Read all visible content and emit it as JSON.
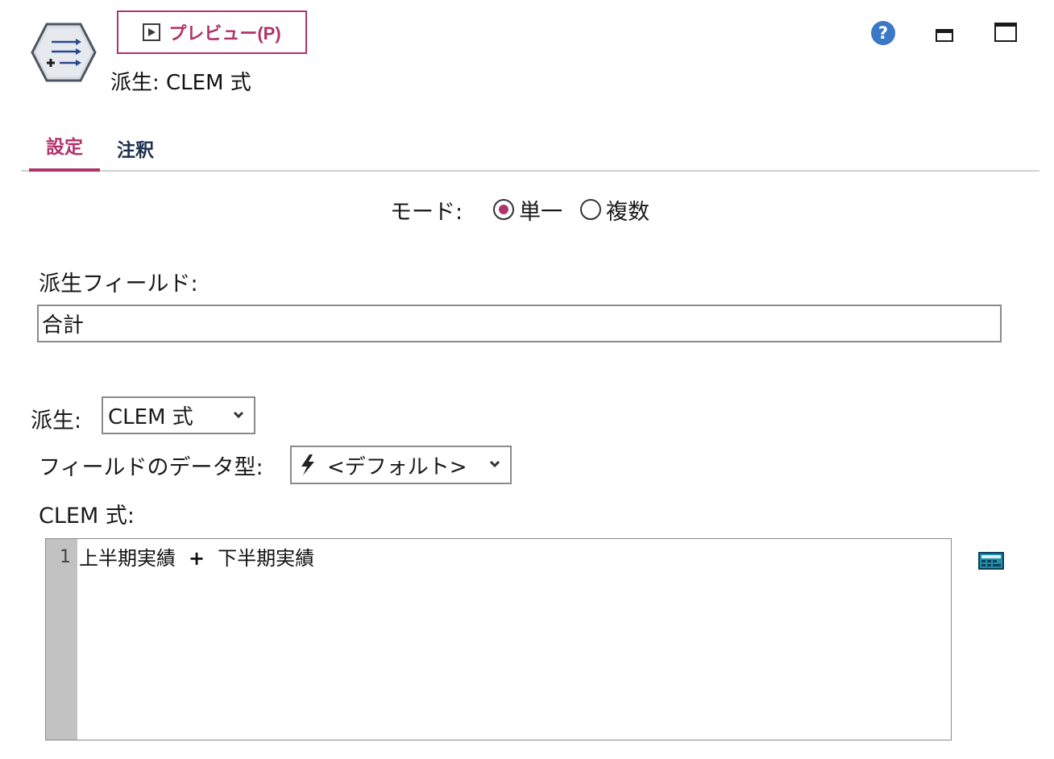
{
  "header": {
    "preview_label": "プレビュー(P)",
    "title": "派生: CLEM 式"
  },
  "tabs": [
    {
      "label": "設定",
      "active": true
    },
    {
      "label": "注釈",
      "active": false
    }
  ],
  "mode": {
    "label": "モード:",
    "options": [
      {
        "label": "単一",
        "selected": true
      },
      {
        "label": "複数",
        "selected": false
      }
    ]
  },
  "derive_field": {
    "label": "派生フィールド:",
    "value": "合計"
  },
  "derive_as": {
    "label": "派生:",
    "value": "CLEM 式"
  },
  "field_type": {
    "label": "フィールドのデータ型:",
    "value": "<デフォルト>"
  },
  "clem": {
    "label": "CLEM 式:",
    "line_number": "1",
    "operand_1": "上半期実績",
    "operator": "+",
    "operand_2": "下半期実績"
  },
  "colors": {
    "accent": "#b1336b",
    "help_blue": "#3a78c8",
    "gutter": "#c2c2c2"
  },
  "icons": [
    "derive-node-icon",
    "play-icon",
    "help-icon",
    "minimize-icon",
    "maximize-icon",
    "lightning-icon",
    "chevron-down-icon",
    "expression-builder-icon"
  ]
}
